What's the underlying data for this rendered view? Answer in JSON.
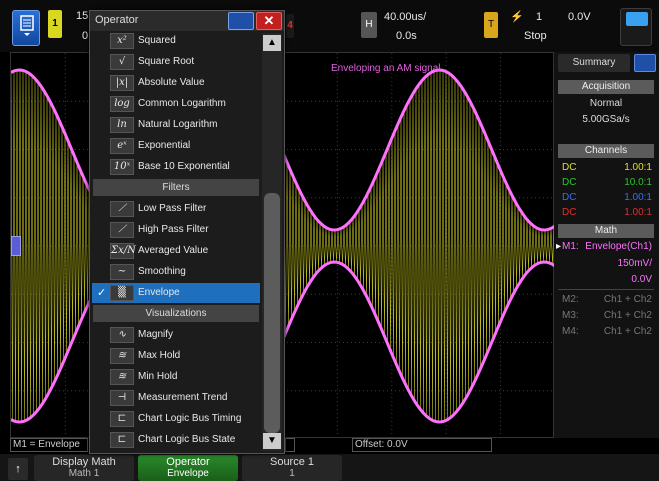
{
  "topbar": {
    "ch1_scale_partial": "15",
    "ch1_offset_partial": "0",
    "ch1_tag": "1",
    "ch4_tag": "4",
    "horiz_tag": "H",
    "timebase": "40.00us/",
    "delay": "0.0s",
    "trig_tag": "T",
    "trig_source": "1",
    "trig_level": "0.0V",
    "run_state": "Stop"
  },
  "scope": {
    "title": "Enveloping an AM signal",
    "colors": {
      "trace": "#d8d820",
      "envelope": "#ff70ff",
      "grid": "#3a3a3a"
    }
  },
  "right_panel": {
    "tab": "Summary",
    "acquisition_header": "Acquisition",
    "acq_mode": "Normal",
    "acq_rate": "5.00GSa/s",
    "channels_header": "Channels",
    "channels": [
      {
        "coupling": "DC",
        "ratio": "1.00:1",
        "color": "#e0e020"
      },
      {
        "coupling": "DC",
        "ratio": "10.0:1",
        "color": "#30c030"
      },
      {
        "coupling": "DC",
        "ratio": "1.00:1",
        "color": "#3070ff"
      },
      {
        "coupling": "DC",
        "ratio": "1.00:1",
        "color": "#e03030"
      }
    ],
    "math_header": "Math",
    "math": [
      {
        "name": "M1:",
        "expr": "Envelope(Ch1)",
        "active": true
      },
      {
        "name": "M2:",
        "expr": "Ch1 + Ch2",
        "active": false
      },
      {
        "name": "M3:",
        "expr": "Ch1 + Ch2",
        "active": false
      },
      {
        "name": "M4:",
        "expr": "Ch1 + Ch2",
        "active": false
      }
    ],
    "m1_scale": "150mV/",
    "m1_offset": "0.0V"
  },
  "status": {
    "math_label": "M1 = Envelope",
    "offset": "Offset: 0.0V"
  },
  "softkeys": {
    "back": "↑",
    "display_math": "Display Math",
    "display_math_value": "Math 1",
    "operator": "Operator",
    "operator_value": "Envelope",
    "source": "Source 1",
    "source_value": "1"
  },
  "menu": {
    "title": "Operator",
    "close": "✕",
    "items_top": [
      {
        "icon": "x²",
        "label": "Squared",
        "icon_name": "squared-icon"
      },
      {
        "icon": "√",
        "label": "Square Root",
        "icon_name": "square-root-icon"
      },
      {
        "icon": "|x|",
        "label": "Absolute Value",
        "icon_name": "absolute-value-icon"
      },
      {
        "icon": "log",
        "label": "Common Logarithm",
        "icon_name": "log-icon"
      },
      {
        "icon": "ln",
        "label": "Natural Logarithm",
        "icon_name": "ln-icon"
      },
      {
        "icon": "eˣ",
        "label": "Exponential",
        "icon_name": "exponential-icon"
      },
      {
        "icon": "10ˣ",
        "label": "Base 10 Exponential",
        "icon_name": "base10-exponential-icon"
      }
    ],
    "filters_header": "Filters",
    "filters": [
      {
        "icon": "⟋",
        "label": "Low Pass Filter",
        "icon_name": "low-pass-filter-icon"
      },
      {
        "icon": "⟋",
        "label": "High Pass Filter",
        "icon_name": "high-pass-filter-icon"
      },
      {
        "icon": "Σx/N",
        "label": "Averaged Value",
        "icon_name": "averaged-value-icon"
      },
      {
        "icon": "∼",
        "label": "Smoothing",
        "icon_name": "smoothing-icon"
      },
      {
        "icon": "▒",
        "label": "Envelope",
        "icon_name": "envelope-icon",
        "selected": true
      }
    ],
    "visualizations_header": "Visualizations",
    "visualizations": [
      {
        "icon": "∿",
        "label": "Magnify",
        "icon_name": "magnify-icon"
      },
      {
        "icon": "≋",
        "label": "Max Hold",
        "icon_name": "max-hold-icon"
      },
      {
        "icon": "≋",
        "label": "Min Hold",
        "icon_name": "min-hold-icon"
      },
      {
        "icon": "⊣",
        "label": "Measurement Trend",
        "icon_name": "measurement-trend-icon"
      },
      {
        "icon": "⊏",
        "label": "Chart Logic Bus Timing",
        "icon_name": "chart-logic-bus-timing-icon"
      },
      {
        "icon": "⊏",
        "label": "Chart Logic Bus State",
        "icon_name": "chart-logic-bus-state-icon"
      }
    ]
  }
}
